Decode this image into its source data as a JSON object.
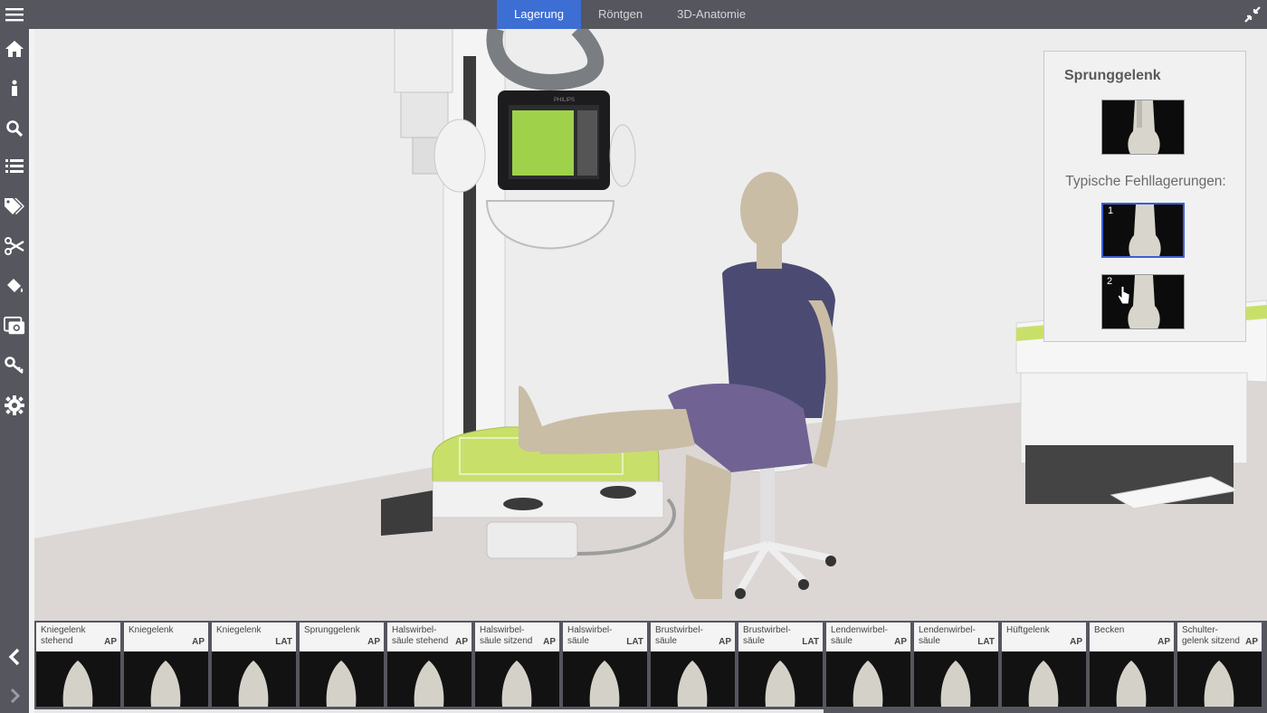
{
  "tabs": [
    {
      "label": "Lagerung",
      "active": true
    },
    {
      "label": "Röntgen",
      "active": false
    },
    {
      "label": "3D-Anatomie",
      "active": false
    }
  ],
  "sidebar": {
    "icons": [
      "home-icon",
      "info-icon",
      "search-icon",
      "list-icon",
      "tags-icon",
      "scissors-icon",
      "paint-bucket-icon",
      "camera-icon",
      "key-icon",
      "gear-icon"
    ],
    "nav": [
      "chevron-left-icon",
      "chevron-right-icon"
    ]
  },
  "info_panel": {
    "title": "Sprunggelenk",
    "subtitle": "Typische Fehllagerungen:",
    "thumbs": [
      {
        "num": ""
      },
      {
        "num": "1"
      },
      {
        "num": "2"
      }
    ]
  },
  "strip": [
    {
      "label": "Kniegelenk stehend",
      "view": "AP"
    },
    {
      "label": "Kniegelenk",
      "view": "AP"
    },
    {
      "label": "Kniegelenk",
      "view": "LAT"
    },
    {
      "label": "Sprunggelenk",
      "view": "AP"
    },
    {
      "label": "Halswirbel-säule stehend",
      "view": "AP"
    },
    {
      "label": "Halswirbel-säule sitzend",
      "view": "AP"
    },
    {
      "label": "Halswirbel-säule",
      "view": "LAT"
    },
    {
      "label": "Brustwirbel-säule",
      "view": "AP"
    },
    {
      "label": "Brustwirbel-säule",
      "view": "LAT"
    },
    {
      "label": "Lendenwirbel-säule",
      "view": "AP"
    },
    {
      "label": "Lendenwirbel-säule",
      "view": "LAT"
    },
    {
      "label": "Hüftgelenk",
      "view": "AP"
    },
    {
      "label": "Becken",
      "view": "AP"
    },
    {
      "label": "Schulter-gelenk sitzend",
      "view": "AP"
    }
  ],
  "device_brand": "PHILIPS",
  "colors": {
    "accent": "#3d6ed4",
    "bar": "#55565e",
    "detector": "#c8e06a"
  }
}
